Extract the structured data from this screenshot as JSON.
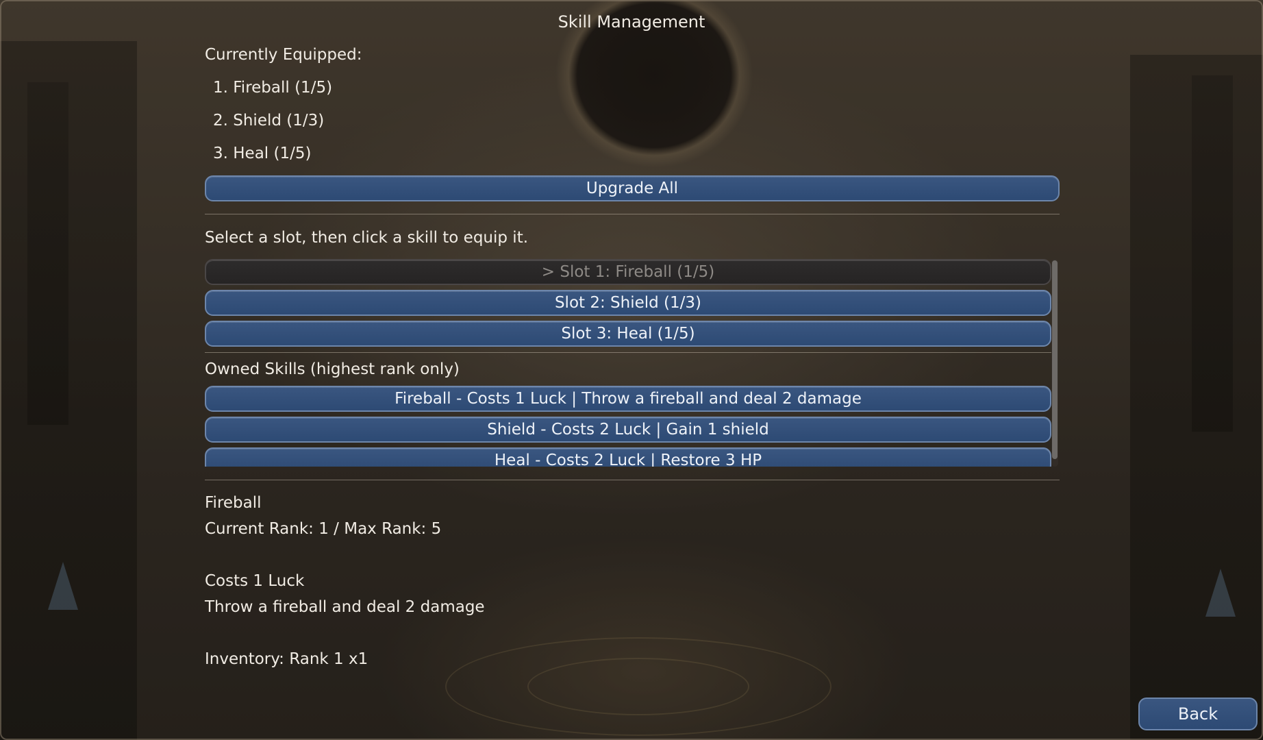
{
  "title": "Skill Management",
  "equipped": {
    "heading": "Currently Equipped:",
    "items": [
      "1. Fireball (1/5)",
      "2. Shield (1/3)",
      "3. Heal (1/5)"
    ]
  },
  "upgrade_all_label": "Upgrade All",
  "instruction": "Select a slot, then click a skill to equip it.",
  "slots": [
    {
      "label": "> Slot 1: Fireball (1/5)",
      "state": "selected"
    },
    {
      "label": "Slot 2: Shield (1/3)",
      "state": "normal"
    },
    {
      "label": "Slot 3: Heal (1/5)",
      "state": "normal"
    }
  ],
  "owned": {
    "heading": "Owned Skills (highest rank only)",
    "skills": [
      "Fireball - Costs 1 Luck | Throw a fireball and deal 2 damage",
      "Shield - Costs 2 Luck | Gain 1 shield",
      "Heal - Costs 2 Luck | Restore 3 HP"
    ]
  },
  "detail": {
    "name": "Fireball",
    "rank": "Current Rank: 1 / Max Rank: 5",
    "cost": "Costs 1 Luck",
    "description": "Throw a fireball and deal 2 damage",
    "inventory": "Inventory: Rank 1 x1"
  },
  "back_label": "Back",
  "colors": {
    "button_fill": "#2d4a74",
    "button_border": "#6d86ab",
    "disabled_fill": "#262424",
    "text": "#f1ece4"
  }
}
